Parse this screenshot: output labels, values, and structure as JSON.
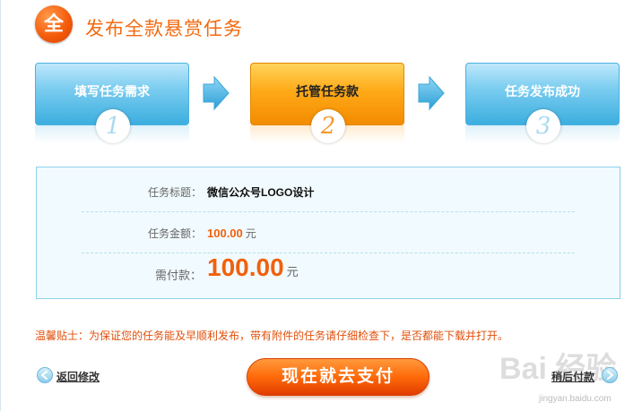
{
  "header": {
    "badge_char": "全",
    "title": "发布全款悬赏任务"
  },
  "steps": [
    {
      "label": "填写任务需求",
      "number": "1",
      "state": "done"
    },
    {
      "label": "托管任务款",
      "number": "2",
      "state": "active"
    },
    {
      "label": "任务发布成功",
      "number": "3",
      "state": "pending"
    }
  ],
  "info": {
    "title_label": "任务标题：",
    "title_value": "微信公众号LOGO设计",
    "amount_label": "任务金额：",
    "amount_value": "100.00",
    "amount_unit": "元",
    "pay_label": "需付款：",
    "pay_value": "100.00",
    "pay_unit": "元"
  },
  "tip": "温馨贴士：为保证您的任务能及早顺利发布，带有附件的任务请仔细检查下，是否都能下载并打开。",
  "actions": {
    "back_label": "返回修改",
    "pay_label": "现在就去支付",
    "later_label": "稍后付款"
  },
  "watermark": {
    "text": "Bai 经验",
    "sub": "jingyan.baidu.com"
  },
  "colors": {
    "accent": "#f26a10",
    "step_blue": "#3caedf",
    "step_orange": "#ffaa18",
    "box_border": "#8ed0ec"
  },
  "icons": {
    "arrow": "arrow-right-icon",
    "back": "back-circle-icon",
    "forward": "forward-circle-icon"
  }
}
